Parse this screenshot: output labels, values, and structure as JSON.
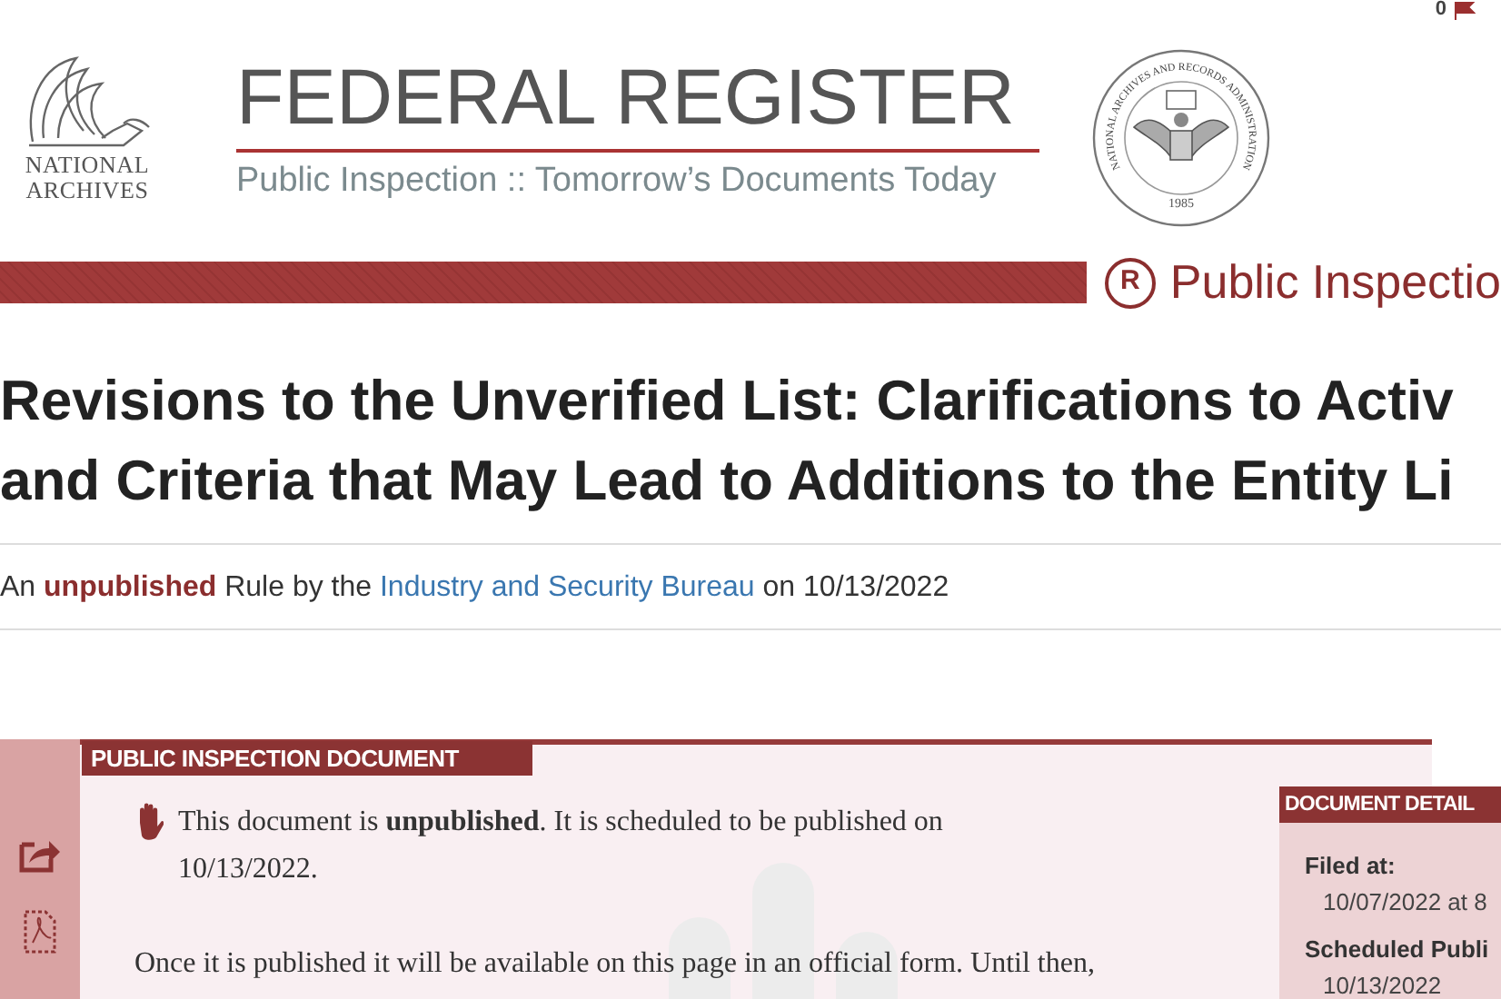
{
  "header": {
    "counter": "0",
    "archives_logo": [
      "NATIONAL",
      "ARCHIVES"
    ],
    "title": "FEDERAL REGISTER",
    "subtitle": "Public Inspection :: Tomorrow’s Documents Today",
    "seal": {
      "ring_text": "NATIONAL ARCHIVES AND RECORDS ADMINISTRATION",
      "year": "1985"
    },
    "section": {
      "icon_letter": "R",
      "label": "Public Inspectio"
    }
  },
  "document": {
    "title_lines": [
      "Revisions to the Unverified List: Clarifications to Activ",
      "and Criteria that May Lead to Additions to the Entity Li"
    ],
    "byline": [
      {
        "kind": "text",
        "text": "An"
      },
      {
        "kind": "emphasis",
        "text": "unpublished"
      },
      {
        "kind": "text",
        "text": "Rule by the"
      },
      {
        "kind": "link",
        "text": "Industry and Security Bureau"
      },
      {
        "kind": "text",
        "text": "on 10/13/2022"
      }
    ]
  },
  "notice": {
    "tab": "PUBLIC INSPECTION DOCUMENT",
    "paragraphs": [
      "This document is **unpublished**. It is scheduled to be published on 10/13/2022.",
      "Once it is published it will be available on this page in an official form. Until then,"
    ]
  },
  "details": {
    "tab": "DOCUMENT DETAIL",
    "fields": [
      {
        "label": "Filed at:",
        "value": "10/07/2022 at 8"
      },
      {
        "label": "Scheduled Publi",
        "value": "10/13/2022"
      }
    ]
  }
}
